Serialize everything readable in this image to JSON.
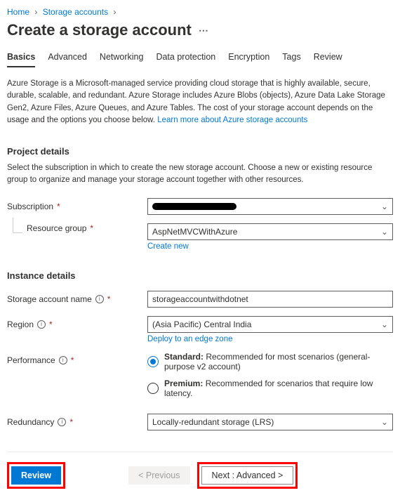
{
  "breadcrumb": {
    "home": "Home",
    "storage": "Storage accounts"
  },
  "title": "Create a storage account",
  "tabs": [
    "Basics",
    "Advanced",
    "Networking",
    "Data protection",
    "Encryption",
    "Tags",
    "Review"
  ],
  "intro_text": "Azure Storage is a Microsoft-managed service providing cloud storage that is highly available, secure, durable, scalable, and redundant. Azure Storage includes Azure Blobs (objects), Azure Data Lake Storage Gen2, Azure Files, Azure Queues, and Azure Tables. The cost of your storage account depends on the usage and the options you choose below. ",
  "intro_link": "Learn more about Azure storage accounts",
  "project": {
    "heading": "Project details",
    "sub": "Select the subscription in which to create the new storage account. Choose a new or existing resource group to organize and manage your storage account together with other resources.",
    "subscription_label": "Subscription",
    "rg_label": "Resource group",
    "rg_value": "AspNetMVCWithAzure",
    "create_new": "Create new"
  },
  "instance": {
    "heading": "Instance details",
    "name_label": "Storage account name",
    "name_value": "storageaccountwithdotnet",
    "region_label": "Region",
    "region_value": "(Asia Pacific) Central India",
    "deploy_link": "Deploy to an edge zone",
    "perf_label": "Performance",
    "perf_standard_title": "Standard:",
    "perf_standard_desc": " Recommended for most scenarios (general-purpose v2 account)",
    "perf_premium_title": "Premium:",
    "perf_premium_desc": " Recommended for scenarios that require low latency.",
    "redundancy_label": "Redundancy",
    "redundancy_value": "Locally-redundant storage (LRS)"
  },
  "footer": {
    "review": "Review",
    "previous": "< Previous",
    "next": "Next : Advanced >"
  }
}
